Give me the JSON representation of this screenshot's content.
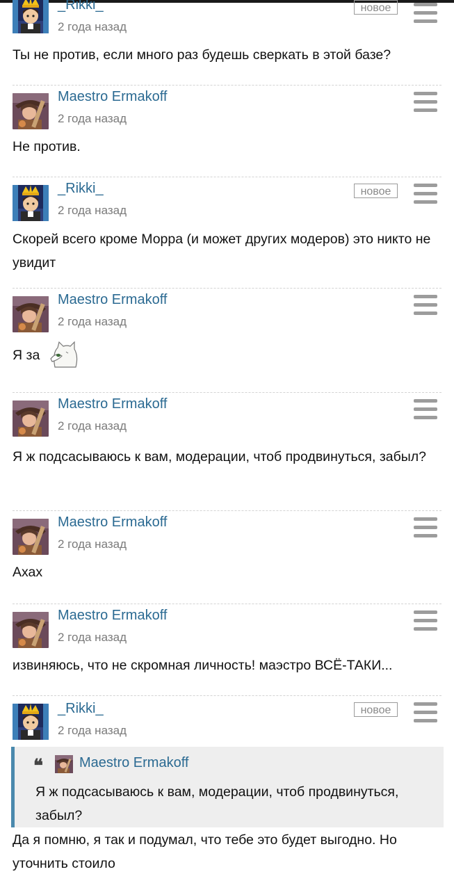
{
  "badge_label": "новое",
  "comments": [
    {
      "author": "_Rikki_",
      "time": "2 года назад",
      "avatar": "rikki",
      "is_new": true,
      "text": "Ты не против, если много раз будешь сверкать в этой базе?"
    },
    {
      "author": "Maestro Ermakoff",
      "time": "2 года назад",
      "avatar": "maestro",
      "is_new": false,
      "text": "Не против."
    },
    {
      "author": "_Rikki_",
      "time": "2 года назад",
      "avatar": "rikki",
      "is_new": true,
      "text": "Скорей всего кроме Морра (и может других модеров) это никто не увидит"
    },
    {
      "author": "Maestro Ermakoff",
      "time": "2 года назад",
      "avatar": "maestro",
      "is_new": false,
      "text": "Я за",
      "sticker": "cat-peeking-sticker"
    },
    {
      "author": "Maestro Ermakoff",
      "time": "2 года назад",
      "avatar": "maestro",
      "is_new": false,
      "text": "Я ж подсасываюсь к вам, модерации, чтоб продвинуться, забыл?"
    },
    {
      "author": "Maestro Ermakoff",
      "time": "2 года назад",
      "avatar": "maestro",
      "is_new": false,
      "text": "Ахах"
    },
    {
      "author": "Maestro Ermakoff",
      "time": "2 года назад",
      "avatar": "maestro",
      "is_new": false,
      "text": "извиняюсь, что не скромная личность! маэстро ВСЁ-ТАКИ..."
    },
    {
      "author": "_Rikki_",
      "time": "2 года назад",
      "avatar": "rikki",
      "is_new": true,
      "quote": {
        "author": "Maestro Ermakoff",
        "text": "Я ж подсасываюсь к вам, модерации, чтоб продвинуться, забыл?"
      },
      "text": "Да я помню, я так и подумал, что тебе это будет выгодно. Но уточнить стоило"
    }
  ],
  "icons": {
    "menu": "hamburger-menu-icon",
    "quote": "quote-mark-icon"
  },
  "colors": {
    "author_link": "#2b6a92",
    "quote_border": "#4a89ad",
    "quote_bg": "#eeeeee",
    "muted": "#7a7a7a"
  }
}
